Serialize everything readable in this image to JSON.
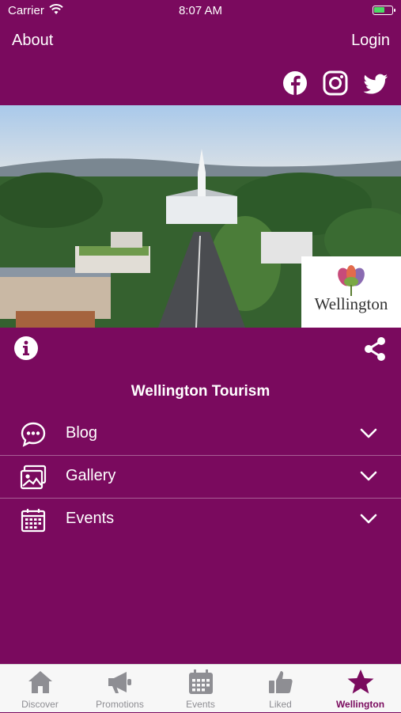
{
  "status_bar": {
    "carrier": "Carrier",
    "time": "8:07 AM"
  },
  "header": {
    "about": "About",
    "login": "Login"
  },
  "social": {
    "icons": [
      "facebook-icon",
      "instagram-icon",
      "twitter-icon"
    ]
  },
  "hero": {
    "logo_text": "Wellington"
  },
  "main": {
    "title": "Wellington Tourism",
    "sections": [
      {
        "label": "Blog",
        "icon": "chat-icon"
      },
      {
        "label": "Gallery",
        "icon": "gallery-icon"
      },
      {
        "label": "Events",
        "icon": "calendar-icon"
      }
    ]
  },
  "tabs": [
    {
      "label": "Discover",
      "icon": "home-icon"
    },
    {
      "label": "Promotions",
      "icon": "megaphone-icon"
    },
    {
      "label": "Events",
      "icon": "calendar-icon"
    },
    {
      "label": "Liked",
      "icon": "thumbs-up-icon"
    },
    {
      "label": "Wellington",
      "icon": "star-icon",
      "active": true
    }
  ],
  "colors": {
    "brand": "#7a0a5e",
    "tab_inactive": "#8e8e93",
    "tab_bg": "#f7f7f7"
  }
}
